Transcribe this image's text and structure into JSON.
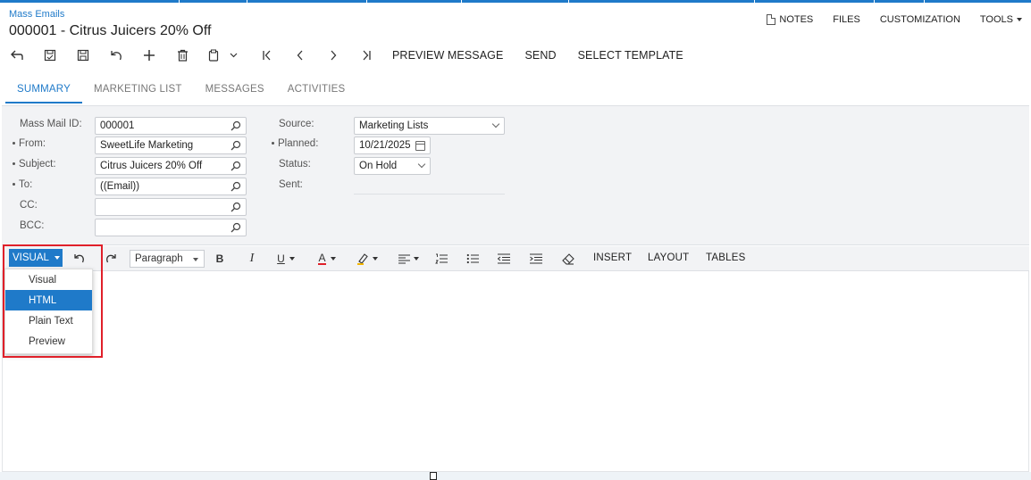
{
  "header": {
    "breadcrumb": "Mass Emails",
    "title": "000001 - Citrus Juicers 20% Off"
  },
  "right_tools": {
    "notes": "NOTES",
    "files": "FILES",
    "customization": "CUSTOMIZATION",
    "tools": "TOOLS"
  },
  "toolbar": {
    "preview_message": "PREVIEW MESSAGE",
    "send": "SEND",
    "select_template": "SELECT TEMPLATE"
  },
  "tabs": [
    "SUMMARY",
    "MARKETING LIST",
    "MESSAGES",
    "ACTIVITIES"
  ],
  "form": {
    "mass_mail_id_label": "Mass Mail ID:",
    "mass_mail_id": "000001",
    "from_label": "From:",
    "from": "SweetLife Marketing",
    "subject_label": "Subject:",
    "subject": "Citrus Juicers 20% Off",
    "to_label": "To:",
    "to": "((Email))",
    "cc_label": "CC:",
    "cc": "",
    "bcc_label": "BCC:",
    "bcc": "",
    "source_label": "Source:",
    "source": "Marketing Lists",
    "planned_label": "Planned:",
    "planned": "10/21/2025",
    "status_label": "Status:",
    "status": "On Hold",
    "sent_label": "Sent:"
  },
  "editor": {
    "mode_label": "VISUAL",
    "paragraph": "Paragraph",
    "bold": "B",
    "italic": "I",
    "underline": "U",
    "font_color": "A",
    "insert": "INSERT",
    "layout": "LAYOUT",
    "tables": "TABLES"
  },
  "mode_menu": {
    "items": [
      "Visual",
      "HTML",
      "Plain Text",
      "Preview"
    ],
    "selected": "HTML"
  },
  "colors": {
    "accent": "#1f7ac9",
    "highlight": "#e0202a"
  }
}
